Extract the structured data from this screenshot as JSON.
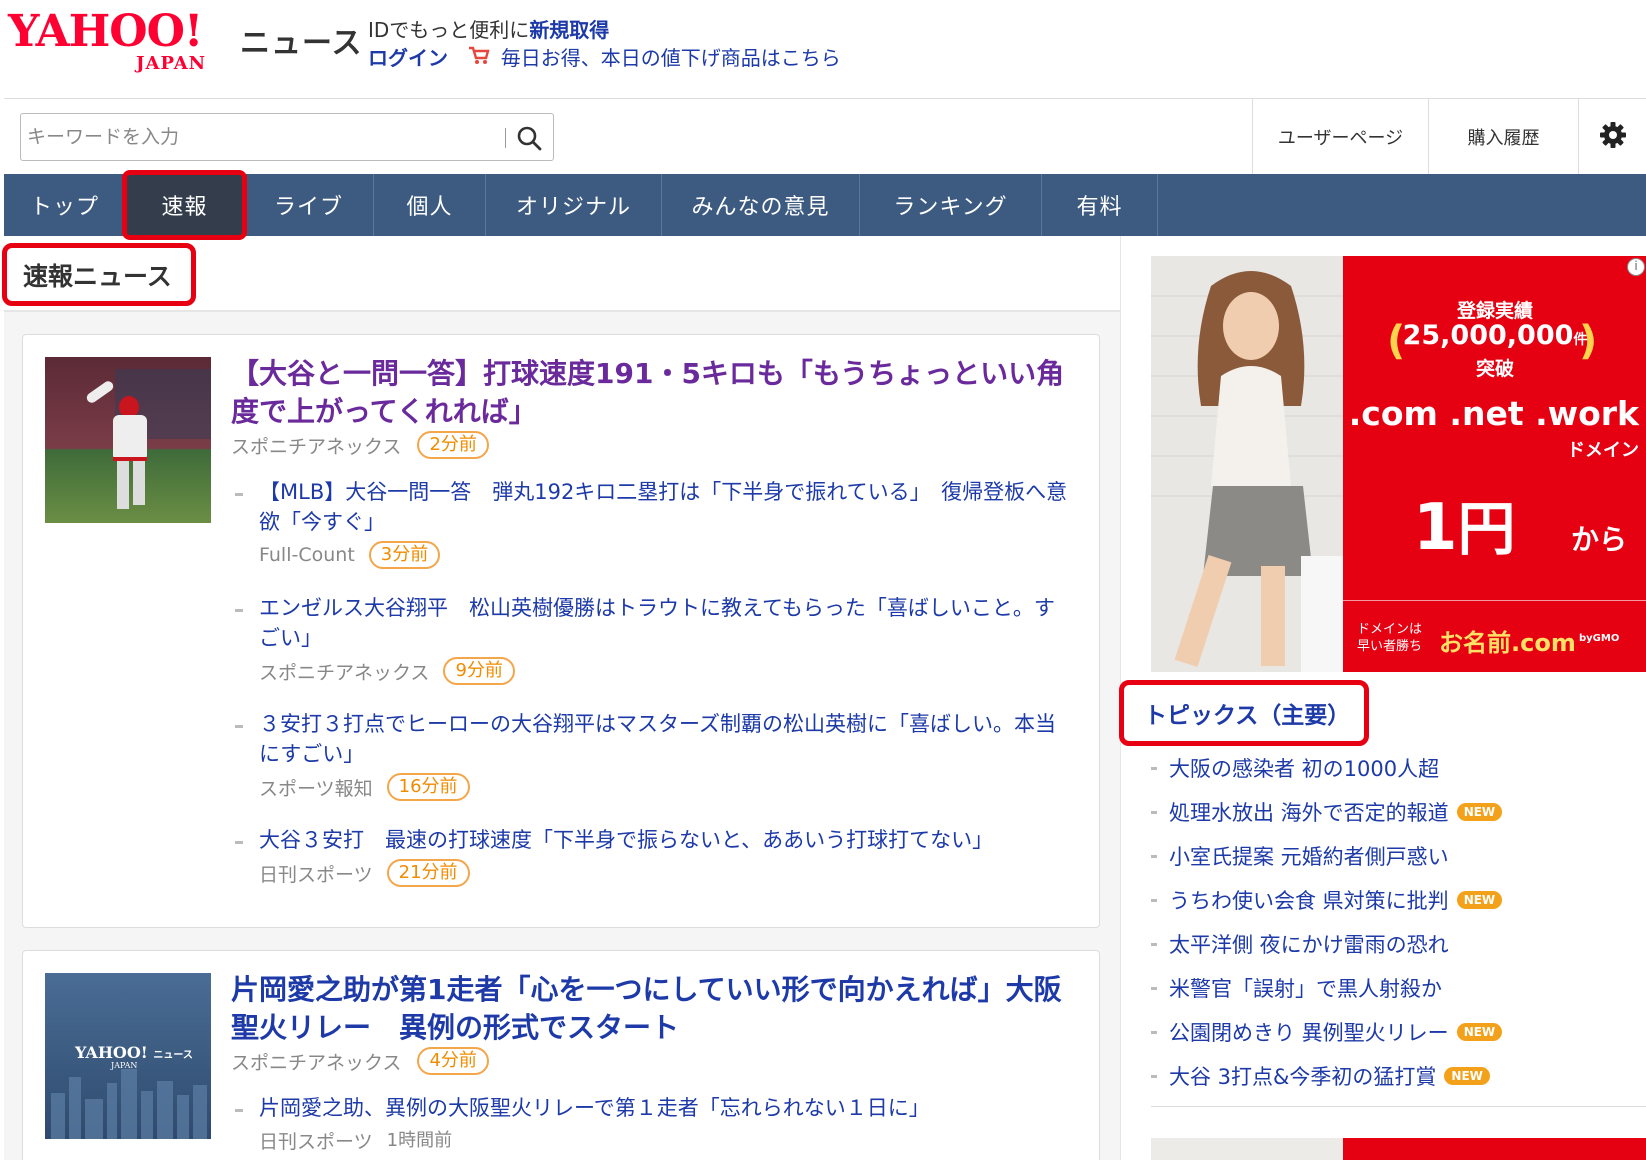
{
  "header": {
    "logo_text": "YAHOO!",
    "logo_sub": "JAPAN",
    "service_name": "ニュース",
    "promo_prefix": "IDでもっと便利に",
    "signup_link": "新規取得",
    "login_link": "ログイン",
    "deal_link": "毎日お得、本日の値下げ商品はこちら"
  },
  "search": {
    "placeholder": "キーワードを入力"
  },
  "utility": {
    "user_page": "ユーザーページ",
    "purchase_history": "購入履歴"
  },
  "nav": {
    "items": [
      "トップ",
      "速報",
      "ライブ",
      "個人",
      "オリジナル",
      "みんなの意見",
      "ランキング",
      "有料"
    ],
    "active": "速報"
  },
  "section_title": "速報ニュース",
  "articles": [
    {
      "title": "【大谷と一問一答】打球速度191・5キロも「もうちょっといい角度で上がってくれれば」",
      "source": "スポニチアネックス",
      "time": "2分前",
      "related": [
        {
          "title": "【MLB】大谷一問一答　弾丸192キロ二塁打は「下半身で振れている」　復帰登板へ意欲「今すぐ」",
          "source": "Full-Count",
          "time": "3分前"
        },
        {
          "title": "エンゼルス大谷翔平　松山英樹優勝はトラウトに教えてもらった「喜ばしいこと。すごい」",
          "source": "スポニチアネックス",
          "time": "9分前"
        },
        {
          "title": "３安打３打点でヒーローの大谷翔平はマスターズ制覇の松山英樹に「喜ばしい。本当にすごい」",
          "source": "スポーツ報知",
          "time": "16分前"
        },
        {
          "title": "大谷３安打　最速の打球速度「下半身で振らないと、ああいう打球打てない」",
          "source": "日刊スポーツ",
          "time": "21分前"
        }
      ]
    },
    {
      "title": "片岡愛之助が第1走者「心を一つにしていい形で向かえれば」大阪聖火リレー　異例の形式でスタート",
      "source": "スポニチアネックス",
      "time": "4分前",
      "thumb_logo": "YAHOO!",
      "thumb_logo_sub": "JAPAN",
      "thumb_service": "ニュース",
      "related": [
        {
          "title": "片岡愛之助、異例の大阪聖火リレーで第１走者「忘れられない１日に」",
          "source": "日刊スポーツ",
          "time": "1時間前"
        }
      ]
    }
  ],
  "ad": {
    "line1": "登録実績",
    "count": "25,000,000",
    "count_unit": "件",
    "line3": "突破",
    "domains": ".com .net .work",
    "domain_label": "ドメイン",
    "price": "1",
    "price_unit": "円",
    "price_suffix": "から",
    "bottom_left": "ドメインは早い者勝ち",
    "brand": "お名前.com",
    "brand_by": "byGMO",
    "info_icon": "info-icon"
  },
  "topics": {
    "title": "トピックス（主要）",
    "new_label": "NEW",
    "items": [
      {
        "text": "大阪の感染者 初の1000人超",
        "is_new": false
      },
      {
        "text": "処理水放出 海外で否定的報道",
        "is_new": true
      },
      {
        "text": "小室氏提案 元婚約者側戸惑い",
        "is_new": false
      },
      {
        "text": "うちわ使い会食 県対策に批判",
        "is_new": true
      },
      {
        "text": "太平洋側 夜にかけ雷雨の恐れ",
        "is_new": false
      },
      {
        "text": "米警官「誤射」で黒人射殺か",
        "is_new": false
      },
      {
        "text": "公園閉めきり 異例聖火リレー",
        "is_new": true
      },
      {
        "text": "大谷 3打点&今季初の猛打賞",
        "is_new": true
      }
    ]
  },
  "colors": {
    "brand_red": "#ff0033",
    "nav_bg": "#3d5b80",
    "nav_active": "#333d4b",
    "link_blue": "#1d3aa8",
    "visited_purple": "#6a2a9c",
    "time_orange": "#f08c00",
    "highlight_red": "#e60012"
  }
}
